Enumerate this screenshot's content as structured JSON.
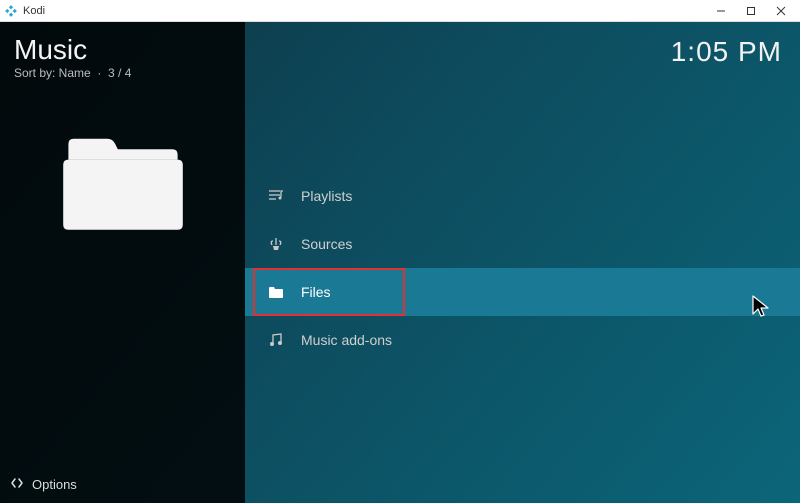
{
  "window": {
    "title": "Kodi"
  },
  "sidebar": {
    "title": "Music",
    "sort_label": "Sort by: Name",
    "position": "3 / 4"
  },
  "clock": "1:05 PM",
  "menu": {
    "items": [
      {
        "label": "Playlists",
        "icon": "playlist-icon"
      },
      {
        "label": "Sources",
        "icon": "sources-icon"
      },
      {
        "label": "Files",
        "icon": "folder-icon"
      },
      {
        "label": "Music add-ons",
        "icon": "music-note-icon"
      }
    ],
    "selected_index": 2
  },
  "footer": {
    "options_label": "Options"
  }
}
